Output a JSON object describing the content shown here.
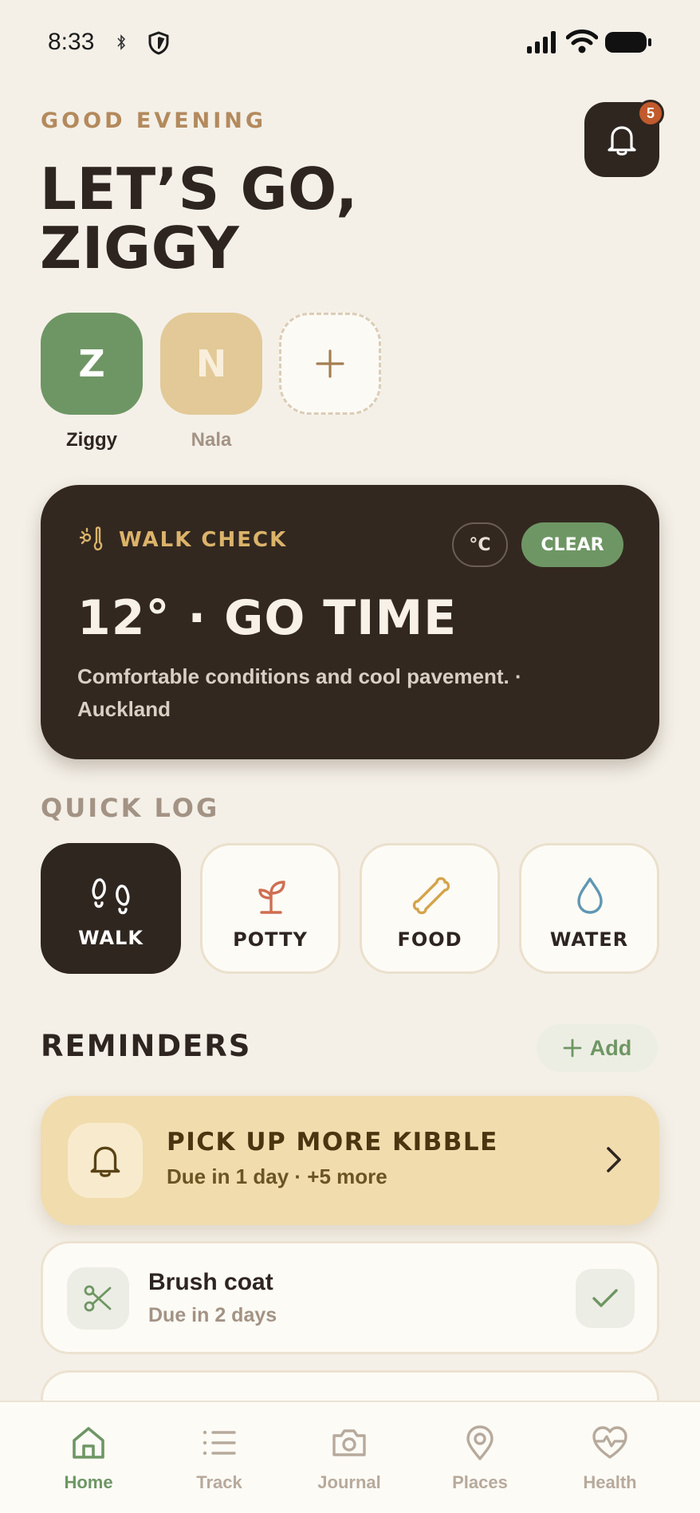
{
  "status_bar": {
    "time": "8:33"
  },
  "header": {
    "greeting": "GOOD EVENING",
    "title_line1": "LET’S GO,",
    "title_line2": "ZIGGY",
    "notification_count": "5"
  },
  "pets": [
    {
      "initial": "Z",
      "name": "Ziggy",
      "color": "#6e9664",
      "selected": true
    },
    {
      "initial": "N",
      "name": "Nala",
      "color": "#e2c997",
      "selected": false
    }
  ],
  "walk_check": {
    "label": "WALK CHECK",
    "unit": "°C",
    "condition": "CLEAR",
    "headline": "12° · GO TIME",
    "description": "Comfortable conditions and cool pavement. · Auckland"
  },
  "quick_log": {
    "title": "QUICK LOG",
    "items": [
      {
        "label": "WALK",
        "icon": "footprints-icon",
        "active": true
      },
      {
        "label": "POTTY",
        "icon": "sprout-icon",
        "active": false
      },
      {
        "label": "FOOD",
        "icon": "bone-icon",
        "active": false
      },
      {
        "label": "WATER",
        "icon": "droplet-icon",
        "active": false
      }
    ]
  },
  "reminders": {
    "title": "REMINDERS",
    "add_label": "Add",
    "featured": {
      "title": "PICK UP MORE KIBBLE",
      "subtitle": "Due in 1 day · +5 more"
    },
    "items": [
      {
        "title": "Brush coat",
        "subtitle": "Due in 2 days",
        "icon": "scissors-icon"
      }
    ]
  },
  "tabs": [
    {
      "label": "Home",
      "icon": "home-icon",
      "active": true
    },
    {
      "label": "Track",
      "icon": "list-icon",
      "active": false
    },
    {
      "label": "Journal",
      "icon": "camera-icon",
      "active": false
    },
    {
      "label": "Places",
      "icon": "map-pin-icon",
      "active": false
    },
    {
      "label": "Health",
      "icon": "heart-pulse-icon",
      "active": false
    }
  ],
  "colors": {
    "background": "#f4f0e8",
    "dark": "#2f2620",
    "accent_green": "#6e9664",
    "accent_gold": "#dbb36a",
    "badge": "#c15a2c",
    "reminder_bg": "#f1dcae"
  }
}
